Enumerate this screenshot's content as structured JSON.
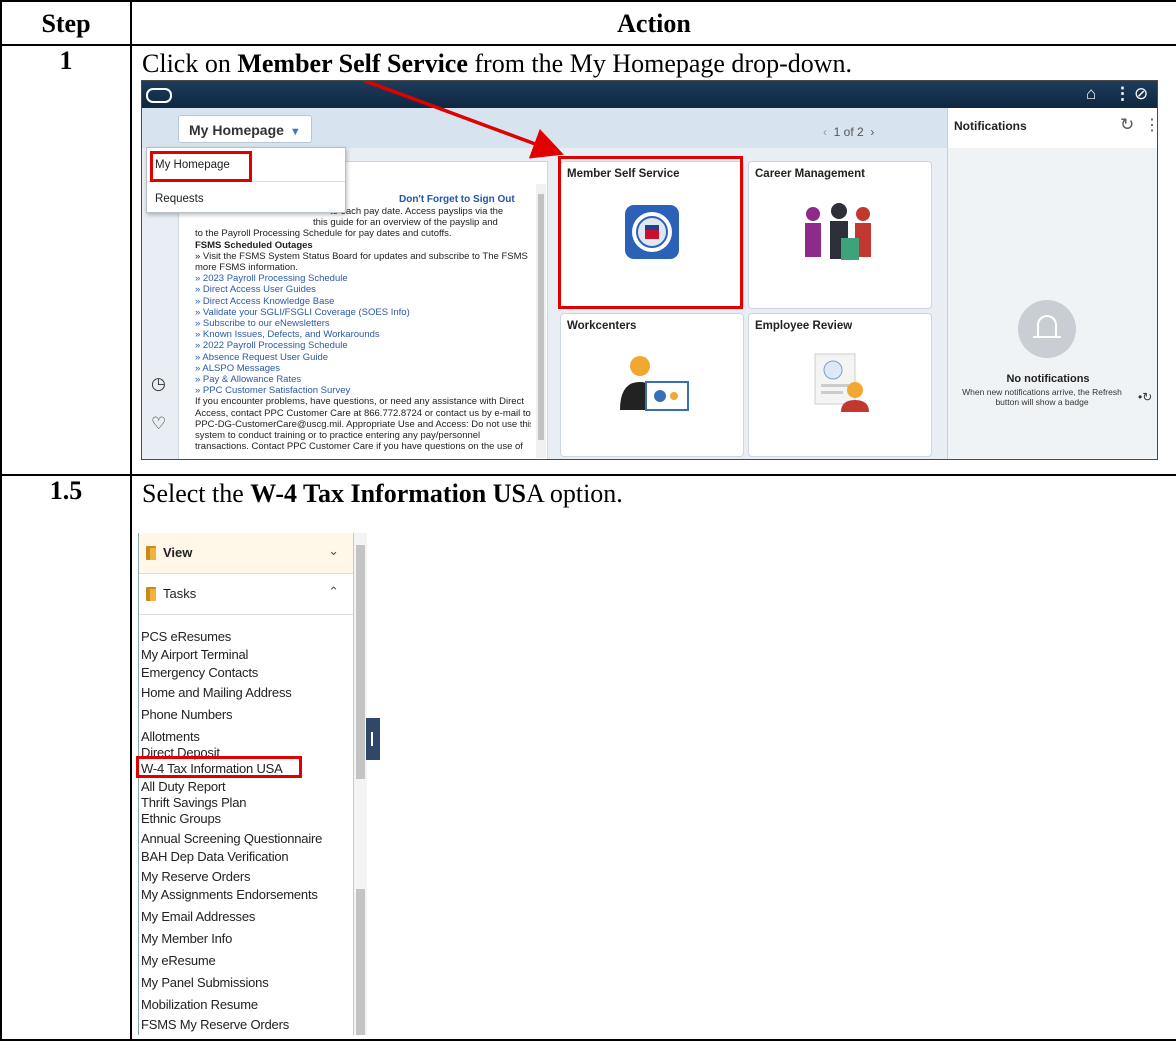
{
  "table": {
    "headers": {
      "step": "Step",
      "action": "Action"
    },
    "rows": [
      {
        "step": "1",
        "instruction_pre": "Click on ",
        "instruction_bold": "Member Self Service",
        "instruction_post": " from the My Homepage drop-down."
      },
      {
        "step": "1.5",
        "instruction_pre": "Select the ",
        "instruction_bold": "W-4 Tax Information US",
        "instruction_post_plain": "A",
        "instruction_post": " option."
      }
    ]
  },
  "homepage": {
    "dropdown_label": "My Homepage",
    "dropdown_items": [
      "My Homepage",
      "Requests"
    ],
    "pager": "1 of 2",
    "notifications": {
      "title": "Notifications",
      "empty_title": "No notifications",
      "empty_line1": "When new notifications arrive, the Refresh",
      "empty_line2": "button will show a badge"
    },
    "message": {
      "heading": "Don't Forget to Sign Out",
      "lines": [
        {
          "t": "to each pay date.  Access payslips via the"
        },
        {
          "t": "this guide for an overview of the payslip and"
        },
        {
          "t": "to the Payroll Processing Schedule for pay dates and cutoffs."
        },
        {
          "t": "FSMS Scheduled Outages",
          "bold": true
        },
        {
          "t": "» Visit the  FSMS System Status Board for updates and subscribe to The FSMS Fix for"
        },
        {
          "t": "more FSMS information."
        },
        {
          "t": "» 2023 Payroll Processing Schedule",
          "link": true
        },
        {
          "t": "» Direct Access User Guides",
          "link": true
        },
        {
          "t": "» Direct Access Knowledge Base",
          "link": true
        },
        {
          "t": "» Validate your SGLI/FSGLI Coverage (SOES Info)",
          "link": true
        },
        {
          "t": "» Subscribe to our eNewsletters",
          "link": true
        },
        {
          "t": "» Known Issues, Defects, and Workarounds",
          "link": true
        },
        {
          "t": "» 2022 Payroll Processing Schedule",
          "link": true
        },
        {
          "t": "» Absence Request User Guide",
          "link": true
        },
        {
          "t": "» ALSPO Messages",
          "link": true
        },
        {
          "t": "» Pay & Allowance Rates",
          "link": true
        },
        {
          "t": "» PPC Customer Satisfaction Survey",
          "link": true
        },
        {
          "t": "If you encounter problems, have questions, or need any assistance with Direct"
        },
        {
          "t": "Access, contact PPC Customer Care at 866.772.8724 or contact us by e-mail to"
        },
        {
          "t": "PPC-DG-CustomerCare@uscg.mil. Appropriate Use and Access: Do not use this"
        },
        {
          "t": "system to conduct training or to practice entering any pay/personnel"
        },
        {
          "t": "transactions. Contact PPC Customer Care if you have questions on the use of"
        }
      ]
    },
    "tiles": [
      "Member Self Service",
      "Career Management",
      "Workcenters",
      "Employee Review"
    ]
  },
  "tasks_menu": {
    "groups": [
      "View",
      "Tasks"
    ],
    "items": [
      "PCS eResumes",
      "My Airport Terminal",
      "Emergency Contacts",
      "Home and Mailing Address",
      "Phone Numbers",
      "Allotments",
      "Direct Deposit",
      "W-4 Tax Information USA",
      "All Duty Report",
      "Thrift Savings Plan",
      "Ethnic Groups",
      "Annual Screening Questionnaire",
      "BAH Dep Data Verification",
      "My Reserve Orders",
      "My Assignments Endorsements",
      "My Email Addresses",
      "My Member Info",
      "My eResume",
      "My Panel Submissions",
      "Mobilization Resume",
      "FSMS My Reserve Orders"
    ]
  },
  "colors": {
    "highlight": "#e00000",
    "banner": "#1e3c5c",
    "link": "#2b59a8"
  }
}
